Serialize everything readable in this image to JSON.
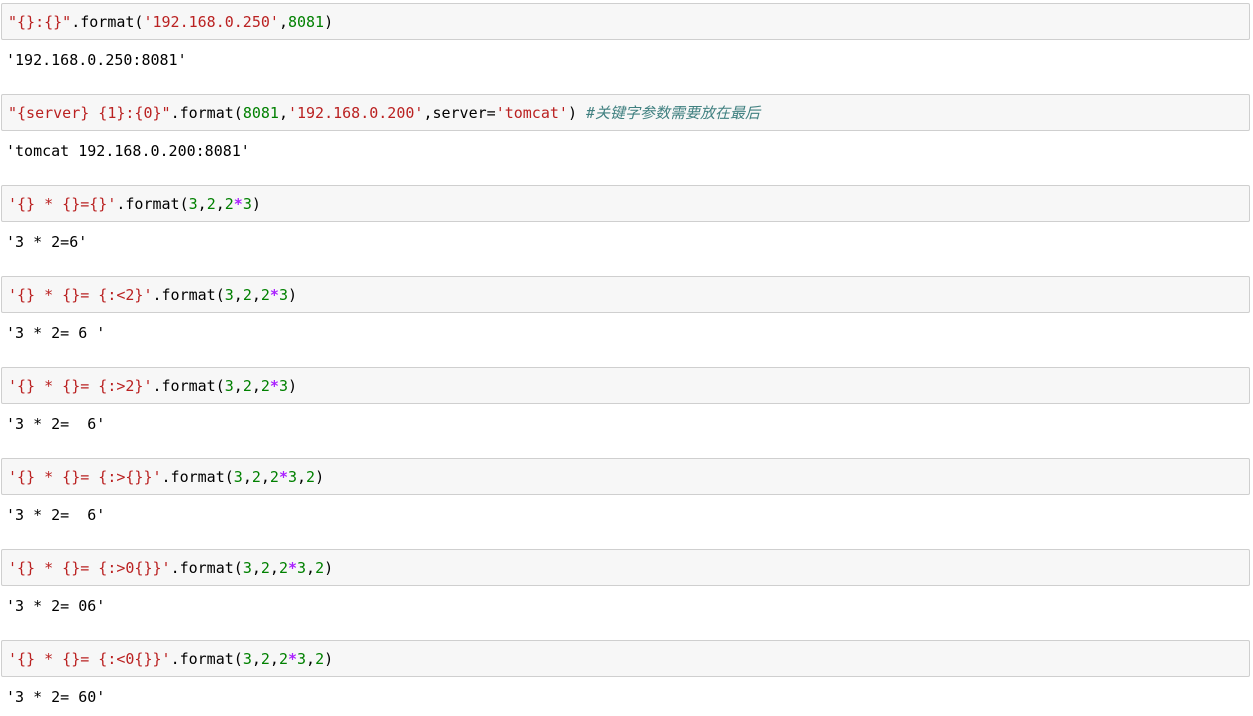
{
  "cells": [
    {
      "input_tokens": [
        {
          "t": "\"{}:{}\"",
          "c": "str"
        },
        {
          "t": ".format(",
          "c": "punc"
        },
        {
          "t": "'192.168.0.250'",
          "c": "str"
        },
        {
          "t": ",",
          "c": "punc"
        },
        {
          "t": "8081",
          "c": "num"
        },
        {
          "t": ")",
          "c": "punc"
        }
      ],
      "output": "'192.168.0.250:8081'"
    },
    {
      "input_tokens": [
        {
          "t": "\"{server} {1}:{0}\"",
          "c": "str"
        },
        {
          "t": ".format(",
          "c": "punc"
        },
        {
          "t": "8081",
          "c": "num"
        },
        {
          "t": ",",
          "c": "punc"
        },
        {
          "t": "'192.168.0.200'",
          "c": "str"
        },
        {
          "t": ",server=",
          "c": "punc"
        },
        {
          "t": "'tomcat'",
          "c": "str"
        },
        {
          "t": ") ",
          "c": "punc"
        },
        {
          "t": "#关键字参数需要放在最后",
          "c": "com"
        }
      ],
      "output": "'tomcat 192.168.0.200:8081'"
    },
    {
      "input_tokens": [
        {
          "t": "'{} * {}={}'",
          "c": "str"
        },
        {
          "t": ".format(",
          "c": "punc"
        },
        {
          "t": "3",
          "c": "num"
        },
        {
          "t": ",",
          "c": "punc"
        },
        {
          "t": "2",
          "c": "num"
        },
        {
          "t": ",",
          "c": "punc"
        },
        {
          "t": "2",
          "c": "num"
        },
        {
          "t": "*",
          "c": "op"
        },
        {
          "t": "3",
          "c": "num"
        },
        {
          "t": ")",
          "c": "punc"
        }
      ],
      "output": "'3 * 2=6'"
    },
    {
      "input_tokens": [
        {
          "t": "'{} * {}= {:<2}'",
          "c": "str"
        },
        {
          "t": ".format(",
          "c": "punc"
        },
        {
          "t": "3",
          "c": "num"
        },
        {
          "t": ",",
          "c": "punc"
        },
        {
          "t": "2",
          "c": "num"
        },
        {
          "t": ",",
          "c": "punc"
        },
        {
          "t": "2",
          "c": "num"
        },
        {
          "t": "*",
          "c": "op"
        },
        {
          "t": "3",
          "c": "num"
        },
        {
          "t": ")",
          "c": "punc"
        }
      ],
      "output": "'3 * 2= 6 '"
    },
    {
      "input_tokens": [
        {
          "t": "'{} * {}= {:>2}'",
          "c": "str"
        },
        {
          "t": ".format(",
          "c": "punc"
        },
        {
          "t": "3",
          "c": "num"
        },
        {
          "t": ",",
          "c": "punc"
        },
        {
          "t": "2",
          "c": "num"
        },
        {
          "t": ",",
          "c": "punc"
        },
        {
          "t": "2",
          "c": "num"
        },
        {
          "t": "*",
          "c": "op"
        },
        {
          "t": "3",
          "c": "num"
        },
        {
          "t": ")",
          "c": "punc"
        }
      ],
      "output": "'3 * 2=  6'"
    },
    {
      "input_tokens": [
        {
          "t": "'{} * {}= {:>{}}'",
          "c": "str"
        },
        {
          "t": ".format(",
          "c": "punc"
        },
        {
          "t": "3",
          "c": "num"
        },
        {
          "t": ",",
          "c": "punc"
        },
        {
          "t": "2",
          "c": "num"
        },
        {
          "t": ",",
          "c": "punc"
        },
        {
          "t": "2",
          "c": "num"
        },
        {
          "t": "*",
          "c": "op"
        },
        {
          "t": "3",
          "c": "num"
        },
        {
          "t": ",",
          "c": "punc"
        },
        {
          "t": "2",
          "c": "num"
        },
        {
          "t": ")",
          "c": "punc"
        }
      ],
      "output": "'3 * 2=  6'"
    },
    {
      "input_tokens": [
        {
          "t": "'{} * {}= {:>0{}}'",
          "c": "str"
        },
        {
          "t": ".format(",
          "c": "punc"
        },
        {
          "t": "3",
          "c": "num"
        },
        {
          "t": ",",
          "c": "punc"
        },
        {
          "t": "2",
          "c": "num"
        },
        {
          "t": ",",
          "c": "punc"
        },
        {
          "t": "2",
          "c": "num"
        },
        {
          "t": "*",
          "c": "op"
        },
        {
          "t": "3",
          "c": "num"
        },
        {
          "t": ",",
          "c": "punc"
        },
        {
          "t": "2",
          "c": "num"
        },
        {
          "t": ")",
          "c": "punc"
        }
      ],
      "output": "'3 * 2= 06'"
    },
    {
      "input_tokens": [
        {
          "t": "'{} * {}= {:<0{}}'",
          "c": "str"
        },
        {
          "t": ".format(",
          "c": "punc"
        },
        {
          "t": "3",
          "c": "num"
        },
        {
          "t": ",",
          "c": "punc"
        },
        {
          "t": "2",
          "c": "num"
        },
        {
          "t": ",",
          "c": "punc"
        },
        {
          "t": "2",
          "c": "num"
        },
        {
          "t": "*",
          "c": "op"
        },
        {
          "t": "3",
          "c": "num"
        },
        {
          "t": ",",
          "c": "punc"
        },
        {
          "t": "2",
          "c": "num"
        },
        {
          "t": ")",
          "c": "punc"
        }
      ],
      "output": "'3 * 2= 60'"
    }
  ]
}
